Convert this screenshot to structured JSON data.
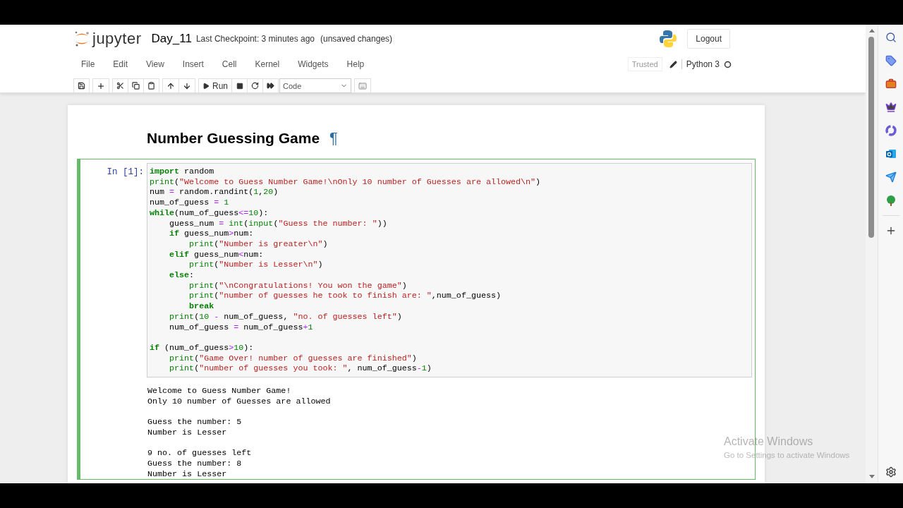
{
  "header": {
    "logo": "jupyter",
    "notebook_name": "Day_11",
    "checkpoint": "Last Checkpoint: 3 minutes ago",
    "save_status": "(unsaved changes)",
    "logout": "Logout"
  },
  "menu": [
    "File",
    "Edit",
    "View",
    "Insert",
    "Cell",
    "Kernel",
    "Widgets",
    "Help"
  ],
  "kernel": {
    "trusted": "Trusted",
    "name": "Python 3"
  },
  "toolbar": {
    "run": "Run",
    "cell_type": "Code"
  },
  "notebook": {
    "heading": "Number Guessing Game",
    "anchor": "¶",
    "cell": {
      "prompt": "In [1]:",
      "selected": true,
      "code_blocks": [
        [
          [
            {
              "kind": "kw",
              "text": "import"
            },
            {
              "kind": "p",
              "text": " random"
            }
          ],
          [
            {
              "kind": "b",
              "text": "print"
            },
            {
              "kind": "p",
              "text": "("
            },
            {
              "kind": "s",
              "text": "\"Welcome to Guess Number Game!\\nOnly 10 number of Guesses are allowed\\n\""
            },
            {
              "kind": "p",
              "text": ")"
            }
          ],
          [
            {
              "kind": "p",
              "text": "num "
            },
            {
              "kind": "o",
              "text": "="
            },
            {
              "kind": "p",
              "text": " random.randint("
            },
            {
              "kind": "n",
              "text": "1"
            },
            {
              "kind": "p",
              "text": ","
            },
            {
              "kind": "n",
              "text": "20"
            },
            {
              "kind": "p",
              "text": ")"
            }
          ],
          [
            {
              "kind": "p",
              "text": "num_of_guess "
            },
            {
              "kind": "o",
              "text": "="
            },
            {
              "kind": "n",
              "text": " 1"
            }
          ],
          [
            {
              "kind": "kw",
              "text": "while"
            },
            {
              "kind": "p",
              "text": "(num_of_guess"
            },
            {
              "kind": "o",
              "text": "<="
            },
            {
              "kind": "n",
              "text": "10"
            },
            {
              "kind": "p",
              "text": "):"
            }
          ],
          [
            {
              "kind": "p",
              "text": "    guess_num "
            },
            {
              "kind": "o",
              "text": "="
            },
            {
              "kind": "b",
              "text": " int"
            },
            {
              "kind": "p",
              "text": "("
            },
            {
              "kind": "b",
              "text": "input"
            },
            {
              "kind": "p",
              "text": "("
            },
            {
              "kind": "s",
              "text": "\"Guess the number: \""
            },
            {
              "kind": "p",
              "text": "))"
            }
          ],
          [
            {
              "kind": "kw",
              "text": "    if"
            },
            {
              "kind": "p",
              "text": " guess_num"
            },
            {
              "kind": "o",
              "text": ">"
            },
            {
              "kind": "p",
              "text": "num:"
            }
          ],
          [
            {
              "kind": "b",
              "text": "        print"
            },
            {
              "kind": "p",
              "text": "("
            },
            {
              "kind": "s",
              "text": "\"Number is greater\\n\""
            },
            {
              "kind": "p",
              "text": ")"
            }
          ],
          [
            {
              "kind": "kw",
              "text": "    elif"
            },
            {
              "kind": "p",
              "text": " guess_num"
            },
            {
              "kind": "o",
              "text": "<"
            },
            {
              "kind": "p",
              "text": "num:"
            }
          ],
          [
            {
              "kind": "b",
              "text": "        print"
            },
            {
              "kind": "p",
              "text": "("
            },
            {
              "kind": "s",
              "text": "\"Number is Lesser\\n\""
            },
            {
              "kind": "p",
              "text": ")"
            }
          ],
          [
            {
              "kind": "kw",
              "text": "    else"
            },
            {
              "kind": "p",
              "text": ":"
            }
          ],
          [
            {
              "kind": "b",
              "text": "        print"
            },
            {
              "kind": "p",
              "text": "("
            },
            {
              "kind": "s",
              "text": "\"\\nCongratulations! You won the game\""
            },
            {
              "kind": "p",
              "text": ")"
            }
          ],
          [
            {
              "kind": "b",
              "text": "        print"
            },
            {
              "kind": "p",
              "text": "("
            },
            {
              "kind": "s",
              "text": "\"number of guesses he took to finish are: \""
            },
            {
              "kind": "p",
              "text": ",num_of_guess)"
            }
          ],
          [
            {
              "kind": "kw",
              "text": "        break"
            }
          ],
          [
            {
              "kind": "b",
              "text": "    print"
            },
            {
              "kind": "p",
              "text": "("
            },
            {
              "kind": "n",
              "text": "10"
            },
            {
              "kind": "o",
              "text": " -"
            },
            {
              "kind": "p",
              "text": " num_of_guess, "
            },
            {
              "kind": "s",
              "text": "\"no. of guesses left\""
            },
            {
              "kind": "p",
              "text": ")"
            }
          ],
          [
            {
              "kind": "p",
              "text": "    num_of_guess "
            },
            {
              "kind": "o",
              "text": "="
            },
            {
              "kind": "p",
              "text": " num_of_guess"
            },
            {
              "kind": "o",
              "text": "+"
            },
            {
              "kind": "n",
              "text": "1"
            }
          ]
        ],
        [
          [
            {
              "kind": "kw",
              "text": "if"
            },
            {
              "kind": "p",
              "text": " (num_of_guess"
            },
            {
              "kind": "o",
              "text": ">"
            },
            {
              "kind": "n",
              "text": "10"
            },
            {
              "kind": "p",
              "text": "):"
            }
          ],
          [
            {
              "kind": "b",
              "text": "    print"
            },
            {
              "kind": "p",
              "text": "("
            },
            {
              "kind": "s",
              "text": "\"Game Over! number of guesses are finished\""
            },
            {
              "kind": "p",
              "text": ")"
            }
          ],
          [
            {
              "kind": "b",
              "text": "    print"
            },
            {
              "kind": "p",
              "text": "("
            },
            {
              "kind": "s",
              "text": "\"number of guesses you took: \""
            },
            {
              "kind": "p",
              "text": ", num_of_guess"
            },
            {
              "kind": "o",
              "text": "-"
            },
            {
              "kind": "n",
              "text": "1"
            },
            {
              "kind": "p",
              "text": ")"
            }
          ]
        ]
      ],
      "output_blocks": [
        [
          "Welcome to Guess Number Game!",
          "Only 10 number of Guesses are allowed"
        ],
        [
          "Guess the number: 5",
          "Number is Lesser"
        ],
        [
          "9 no. of guesses left",
          "Guess the number: 8",
          "Number is Lesser"
        ]
      ]
    }
  },
  "os_notice": {
    "title": "Activate Windows",
    "subtitle": "Go to Settings to activate Windows"
  }
}
